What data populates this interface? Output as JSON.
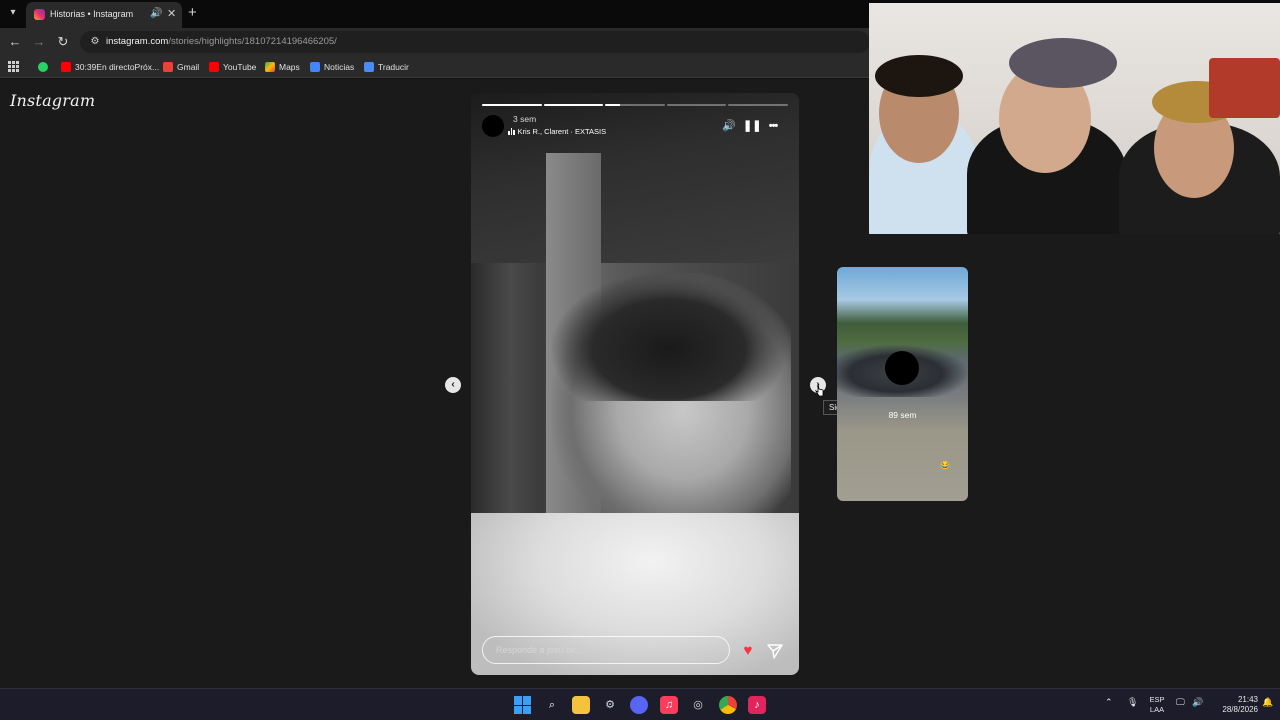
{
  "browser": {
    "tab": {
      "title": "Historias • Instagram"
    },
    "address": {
      "host": "instagram.com",
      "path": "/stories/highlights/18107214196466205/"
    },
    "bookmarks": [
      {
        "label": "30:39En directoPróx...",
        "icon": "youtube-live-icon",
        "color": "#ff0000"
      },
      {
        "label": "Gmail",
        "icon": "gmail-icon",
        "color": "#ea4335"
      },
      {
        "label": "YouTube",
        "icon": "youtube-icon",
        "color": "#ff0000"
      },
      {
        "label": "Maps",
        "icon": "maps-icon",
        "color": "#34a853"
      },
      {
        "label": "Noticias",
        "icon": "news-icon",
        "color": "#4285f4"
      },
      {
        "label": "Traducir",
        "icon": "translate-icon",
        "color": "#4a8cf7"
      }
    ]
  },
  "instagram": {
    "logo": "Instagram",
    "story": {
      "time": "3 sem",
      "music": "Kris R., Clarent · EXTASIS",
      "progress": [
        1,
        1,
        0.25,
        0,
        0
      ],
      "reply_placeholder": "Responde a josu.bv..."
    },
    "next_tooltip": "Siguiente",
    "next_preview": {
      "time": "89 sem",
      "emoji": "😂"
    }
  },
  "taskbar": {
    "lang_top": "ESP",
    "lang_bottom": "LAA",
    "time": "21:43",
    "date": "28/8/2026"
  },
  "colors": {
    "accent_heart": "#ff3040",
    "page_bg": "#1a1a1a",
    "taskbar_bg": "#1c1c2a"
  }
}
